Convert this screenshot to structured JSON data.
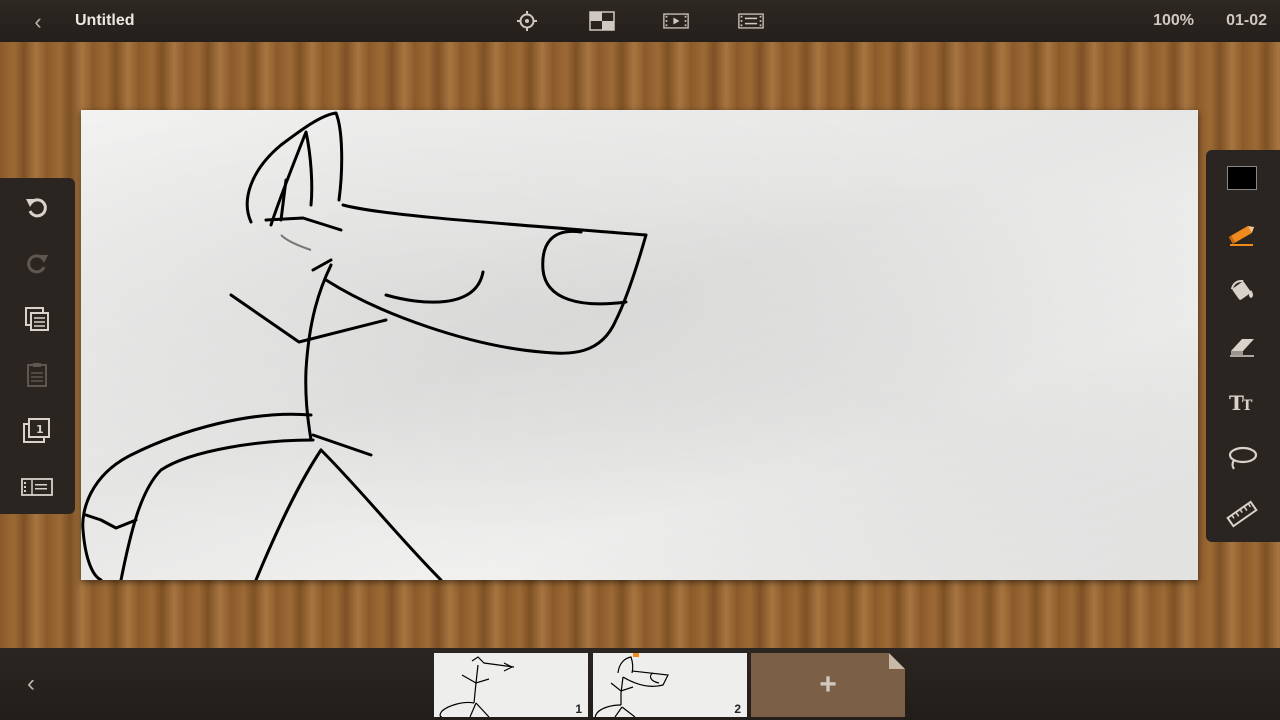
{
  "app": {
    "title": "Untitled",
    "zoom": "100%",
    "frame_indicator": "01-02"
  },
  "toolbar": {
    "top_icons": [
      "settings-gear-icon",
      "layers-grid-icon",
      "play-frames-icon",
      "frame-options-icon"
    ],
    "color_swatch": "#000000",
    "accent": "#f08a1c"
  },
  "left_tools": [
    "undo-icon",
    "redo-icon",
    "copy-icon",
    "paste-icon",
    "onion-skin-icon",
    "frame-list-icon"
  ],
  "right_tools": [
    "color-swatch",
    "pencil-icon",
    "fill-bucket-icon",
    "eraser-icon",
    "text-icon",
    "lasso-icon",
    "ruler-icon"
  ],
  "frames": {
    "items": [
      {
        "number": "1"
      },
      {
        "number": "2"
      }
    ],
    "add_label": "+"
  }
}
